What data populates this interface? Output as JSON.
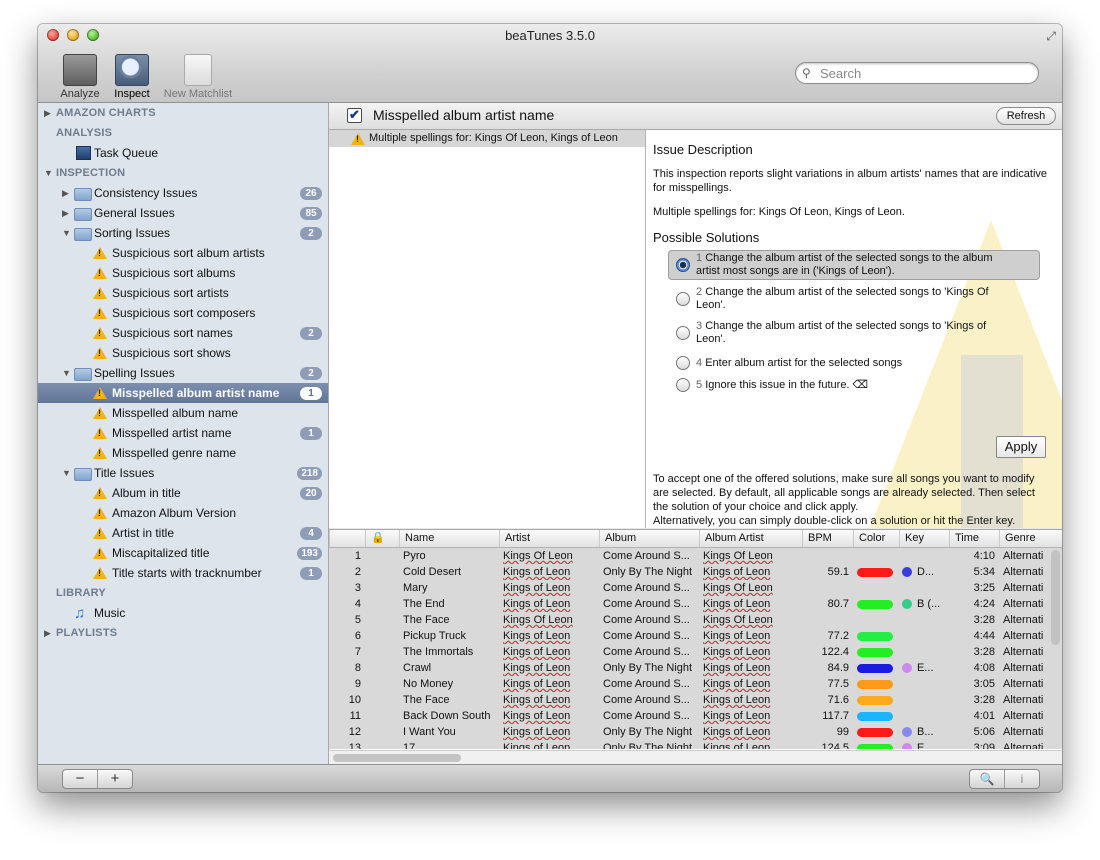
{
  "window": {
    "title": "beaTunes 3.5.0"
  },
  "toolbar": {
    "analyze_label": "Analyze",
    "inspect_label": "Inspect",
    "matchlist_label": "New Matchlist",
    "search_placeholder": "Search"
  },
  "sidebar": {
    "amazon_charts": "AMAZON CHARTS",
    "analysis": "ANALYSIS",
    "task_queue": "Task Queue",
    "inspection": "INSPECTION",
    "consistency": {
      "label": "Consistency Issues",
      "count": "26"
    },
    "general": {
      "label": "General Issues",
      "count": "85"
    },
    "sorting": {
      "label": "Sorting Issues",
      "count": "2"
    },
    "sorting_items": [
      {
        "label": "Suspicious sort album artists",
        "count": ""
      },
      {
        "label": "Suspicious sort albums",
        "count": ""
      },
      {
        "label": "Suspicious sort artists",
        "count": ""
      },
      {
        "label": "Suspicious sort composers",
        "count": ""
      },
      {
        "label": "Suspicious sort names",
        "count": "2"
      },
      {
        "label": "Suspicious sort shows",
        "count": ""
      }
    ],
    "spelling": {
      "label": "Spelling Issues",
      "count": "2"
    },
    "spelling_items": [
      {
        "label": "Misspelled album artist name",
        "count": "1"
      },
      {
        "label": "Misspelled album name",
        "count": ""
      },
      {
        "label": "Misspelled artist name",
        "count": "1"
      },
      {
        "label": "Misspelled genre name",
        "count": ""
      }
    ],
    "title": {
      "label": "Title Issues",
      "count": "218"
    },
    "title_items": [
      {
        "label": "Album in title",
        "count": "20"
      },
      {
        "label": "Amazon Album Version",
        "count": ""
      },
      {
        "label": "Artist in title",
        "count": "4"
      },
      {
        "label": "Miscapitalized title",
        "count": "193"
      },
      {
        "label": "Title starts with tracknumber",
        "count": "1"
      }
    ],
    "library": "LIBRARY",
    "music": "Music",
    "playlists": "PLAYLISTS"
  },
  "issue": {
    "checked": "✔",
    "title": "Misspelled album artist name",
    "refresh_label": "Refresh",
    "list_item": "Multiple spellings for: Kings Of Leon, Kings of Leon"
  },
  "description": {
    "heading": "Issue Description",
    "text1": "This inspection reports slight variations in album artists' names that are indicative for misspellings.",
    "text2": "Multiple spellings for: Kings Of Leon, Kings of Leon.",
    "solutions_heading": "Possible Solutions",
    "solutions": [
      {
        "num": "1",
        "text": "Change the album artist of the selected songs to the album artist most songs are in ('Kings of Leon')."
      },
      {
        "num": "2",
        "text": "Change the album artist of the selected songs to 'Kings Of Leon'."
      },
      {
        "num": "3",
        "text": "Change the album artist of the selected songs to 'Kings of Leon'."
      },
      {
        "num": "4",
        "text": "Enter album artist for the selected songs"
      },
      {
        "num": "5",
        "text": "Ignore this issue in the future. ⌫"
      }
    ],
    "apply_label": "Apply",
    "help1": "To accept one of the offered solutions, make sure all songs you want to modify are selected. By default, all applicable songs are already selected. Then select the solution of your choice and click apply.",
    "help2": "Alternatively, you can simply double-click on a solution or hit the Enter key."
  },
  "table": {
    "columns": [
      "",
      "🔒",
      "Name",
      "Artist",
      "Album",
      "Album Artist",
      "BPM",
      "Color",
      "Key",
      "Time",
      "Genre"
    ],
    "rows": [
      {
        "n": "1",
        "name": "Pyro",
        "artist": "Kings Of Leon",
        "album": "Come Around S...",
        "album_artist": "Kings Of Leon",
        "bpm": "",
        "color": "",
        "key": "",
        "key_color": "",
        "time": "4:10",
        "genre": "Alternati"
      },
      {
        "n": "2",
        "name": "Cold Desert",
        "artist": "Kings of Leon",
        "album": "Only By The Night",
        "album_artist": "Kings of Leon",
        "bpm": "59.1",
        "color": "#ff1a1a",
        "key": "D...",
        "key_color": "#3b3bdc",
        "time": "5:34",
        "genre": "Alternati"
      },
      {
        "n": "3",
        "name": "Mary",
        "artist": "Kings of Leon",
        "album": "Come Around S...",
        "album_artist": "Kings Of Leon",
        "bpm": "",
        "color": "",
        "key": "",
        "key_color": "",
        "time": "3:25",
        "genre": "Alternati"
      },
      {
        "n": "4",
        "name": "The End",
        "artist": "Kings of Leon",
        "album": "Come Around S...",
        "album_artist": "Kings of Leon",
        "bpm": "80.7",
        "color": "#22ee22",
        "key": "B (...",
        "key_color": "#33cc88",
        "time": "4:24",
        "genre": "Alternati"
      },
      {
        "n": "5",
        "name": "The Face",
        "artist": "Kings Of Leon",
        "album": "Come Around S...",
        "album_artist": "Kings Of Leon",
        "bpm": "",
        "color": "",
        "key": "",
        "key_color": "",
        "time": "3:28",
        "genre": "Alternati"
      },
      {
        "n": "6",
        "name": "Pickup Truck",
        "artist": "Kings of Leon",
        "album": "Come Around S...",
        "album_artist": "Kings of Leon",
        "bpm": "77.2",
        "color": "#22ee44",
        "key": "",
        "key_color": "",
        "time": "4:44",
        "genre": "Alternati"
      },
      {
        "n": "7",
        "name": "The Immortals",
        "artist": "Kings of Leon",
        "album": "Come Around S...",
        "album_artist": "Kings of Leon",
        "bpm": "122.4",
        "color": "#22ee22",
        "key": "",
        "key_color": "",
        "time": "3:28",
        "genre": "Alternati"
      },
      {
        "n": "8",
        "name": "Crawl",
        "artist": "Kings of Leon",
        "album": "Only By The Night",
        "album_artist": "Kings of Leon",
        "bpm": "84.9",
        "color": "#1a1ae0",
        "key": "E...",
        "key_color": "#cc88ee",
        "time": "4:08",
        "genre": "Alternati"
      },
      {
        "n": "9",
        "name": "No Money",
        "artist": "Kings of Leon",
        "album": "Come Around S...",
        "album_artist": "Kings of Leon",
        "bpm": "77.5",
        "color": "#ff9a1a",
        "key": "",
        "key_color": "",
        "time": "3:05",
        "genre": "Alternati"
      },
      {
        "n": "10",
        "name": "The Face",
        "artist": "Kings of Leon",
        "album": "Come Around S...",
        "album_artist": "Kings of Leon",
        "bpm": "71.6",
        "color": "#ffaa1a",
        "key": "",
        "key_color": "",
        "time": "3:28",
        "genre": "Alternati"
      },
      {
        "n": "11",
        "name": "Back Down South",
        "artist": "Kings of Leon",
        "album": "Come Around S...",
        "album_artist": "Kings of Leon",
        "bpm": "117.7",
        "color": "#1ab4ff",
        "key": "",
        "key_color": "",
        "time": "4:01",
        "genre": "Alternati"
      },
      {
        "n": "12",
        "name": "I Want You",
        "artist": "Kings of Leon",
        "album": "Only By The Night",
        "album_artist": "Kings of Leon",
        "bpm": "99",
        "color": "#ff1a1a",
        "key": "B...",
        "key_color": "#8888ee",
        "time": "5:06",
        "genre": "Alternati"
      },
      {
        "n": "13",
        "name": "17",
        "artist": "Kings of Leon",
        "album": "Only By The Night",
        "album_artist": "Kings of Leon",
        "bpm": "124.5",
        "color": "#22ee22",
        "key": "E...",
        "key_color": "#cc88ee",
        "time": "3:09",
        "genre": "Alternati"
      }
    ]
  },
  "bottombar": {
    "remove": "−",
    "add": "+",
    "find": "🔍",
    "info": "i"
  }
}
